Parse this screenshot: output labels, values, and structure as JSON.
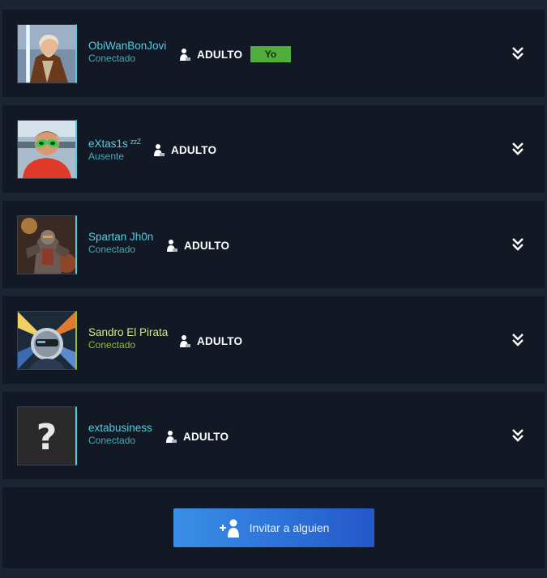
{
  "members": [
    {
      "name": "ObiWanBonJovi",
      "status": "Conectado",
      "badge": "ADULTO",
      "tag": "Yo",
      "state": "online",
      "avatar": "jedi-avatar"
    },
    {
      "name": "eXtas1s",
      "away_marker": "zzZ",
      "status": "Ausente",
      "badge": "ADULTO",
      "state": "away",
      "avatar": "alien-mask-avatar"
    },
    {
      "name": "Spartan Jh0n",
      "status": "Conectado",
      "badge": "ADULTO",
      "state": "online",
      "avatar": "robot-warrior-avatar"
    },
    {
      "name": "Sandro El Pirata",
      "status": "Conectado",
      "badge": "ADULTO",
      "state": "ingame",
      "avatar": "helmet-rider-avatar"
    },
    {
      "name": "extabusiness",
      "status": "Conectado",
      "badge": "ADULTO",
      "state": "online",
      "avatar": "question-mark-avatar"
    }
  ],
  "invite": {
    "label": "Invitar a alguien",
    "icon": "add-user-icon"
  },
  "colors": {
    "online": "#57cbde",
    "ingame": "#90ba3c",
    "me_tag": "#4fae3c",
    "button": "#2b6fd6",
    "card": "#121925",
    "bg": "#1b2432"
  }
}
